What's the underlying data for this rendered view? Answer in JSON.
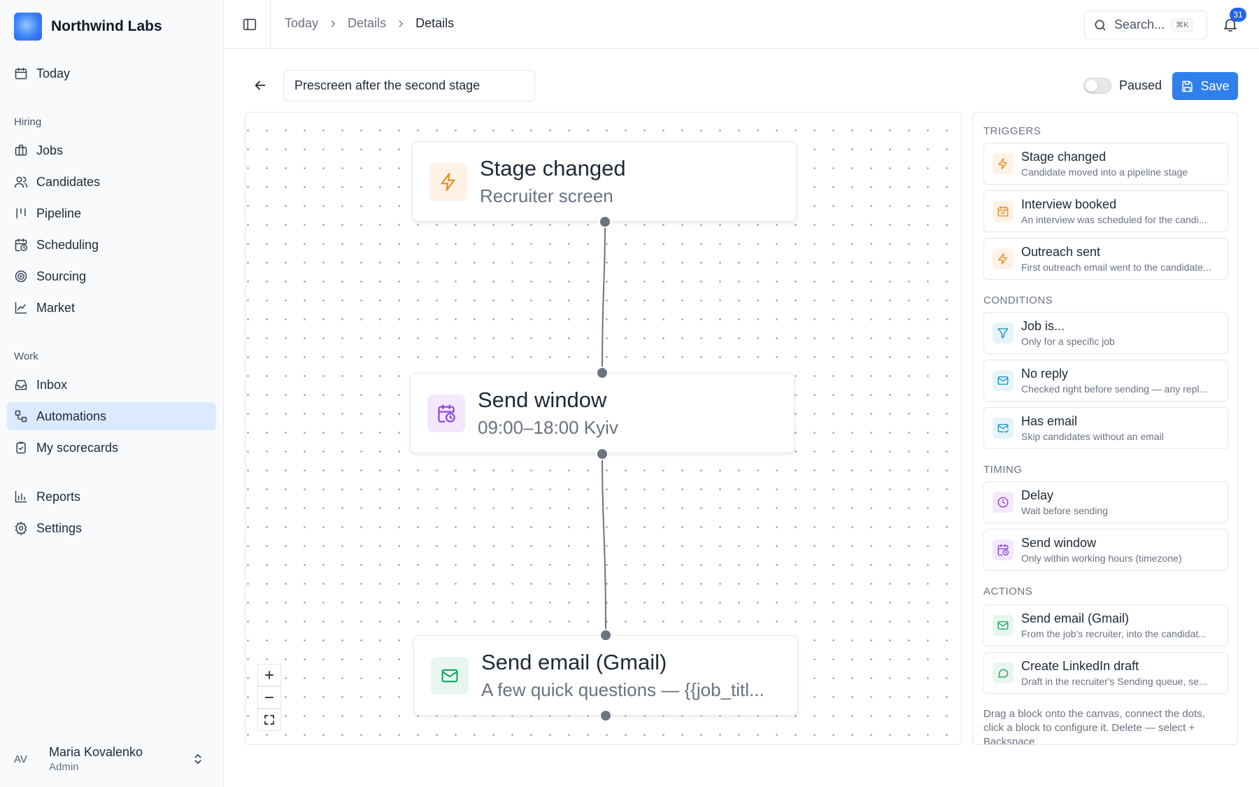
{
  "brand": {
    "name": "Northwind Labs"
  },
  "nav": {
    "today": "Today",
    "sections": {
      "hiring": "Hiring",
      "work": "Work"
    },
    "items": {
      "jobs": "Jobs",
      "candidates": "Candidates",
      "pipeline": "Pipeline",
      "scheduling": "Scheduling",
      "sourcing": "Sourcing",
      "market": "Market",
      "inbox": "Inbox",
      "automations": "Automations",
      "scorecards": "My scorecards",
      "reports": "Reports",
      "settings": "Settings"
    },
    "active": "Automations"
  },
  "user": {
    "initials": "AV",
    "name": "Maria Kovalenko",
    "role": "Admin"
  },
  "breadcrumb": [
    "Today",
    "Details",
    "Details"
  ],
  "search": {
    "placeholder": "Search...",
    "shortcut": "⌘K"
  },
  "notifications": {
    "count": "31"
  },
  "automation": {
    "name": "Prescreen after the second stage",
    "status_label": "Paused",
    "enabled": false,
    "save_label": "Save"
  },
  "canvas": {
    "nodes": [
      {
        "title": "Stage changed",
        "subtitle": "Recruiter screen",
        "icon": "bolt-icon",
        "color": "#ea8a1a"
      },
      {
        "title": "Send window",
        "subtitle": "09:00–18:00 Kyiv",
        "icon": "calendar-clock-icon",
        "color": "#8b3fd9"
      },
      {
        "title": "Send email (Gmail)",
        "subtitle": "A few quick questions — {{job_titl...",
        "icon": "mail-icon",
        "color": "#16a06a"
      }
    ],
    "zoom_controls": [
      "+",
      "–",
      "fit"
    ]
  },
  "palette": {
    "triggers_title": "TRIGGERS",
    "conditions_title": "CONDITIONS",
    "timing_title": "TIMING",
    "actions_title": "ACTIONS",
    "triggers": [
      {
        "title": "Stage changed",
        "desc": "Candidate moved into a pipeline stage",
        "icon": "bolt-icon"
      },
      {
        "title": "Interview booked",
        "desc": "An interview was scheduled for the candi...",
        "icon": "calendar-icon"
      },
      {
        "title": "Outreach sent",
        "desc": "First outreach email went to the candidate...",
        "icon": "bolt-icon"
      }
    ],
    "conditions": [
      {
        "title": "Job is...",
        "desc": "Only for a specific job",
        "icon": "filter-icon"
      },
      {
        "title": "No reply",
        "desc": "Checked right before sending — any repl...",
        "icon": "mail-icon"
      },
      {
        "title": "Has email",
        "desc": "Skip candidates without an email",
        "icon": "mail-check-icon"
      }
    ],
    "timing": [
      {
        "title": "Delay",
        "desc": "Wait before sending",
        "icon": "clock-icon"
      },
      {
        "title": "Send window",
        "desc": "Only within working hours (timezone)",
        "icon": "calendar-clock-icon"
      }
    ],
    "actions": [
      {
        "title": "Send email (Gmail)",
        "desc": "From the job's recruiter, into the candidat...",
        "icon": "mail-icon"
      },
      {
        "title": "Create LinkedIn draft",
        "desc": "Draft in the recruiter's Sending queue, se...",
        "icon": "message-icon"
      }
    ],
    "help": "Drag a block onto the canvas, connect the dots, click a block to configure it. Delete — select + Backspace"
  },
  "colors": {
    "accent": "#2f80ed",
    "active_nav_bg": "#dbeafe",
    "trigger": "#ea8a1a",
    "condition": "#0e8fbf",
    "timing": "#8b3fd9",
    "action": "#16a06a"
  }
}
